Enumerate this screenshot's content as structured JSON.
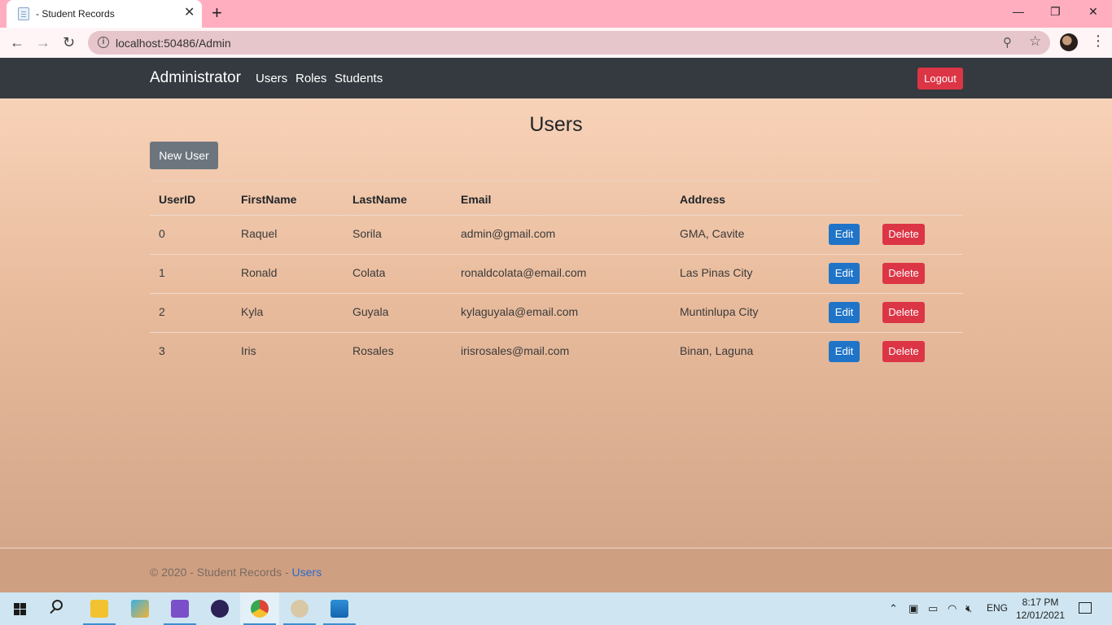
{
  "browser": {
    "tab_title": "- Student Records",
    "tab_close": "✕",
    "new_tab": "+",
    "url": "localhost:50486/Admin",
    "minimize": "—",
    "maximize": "❐",
    "close": "✕"
  },
  "navbar": {
    "brand": "Administrator",
    "links": [
      "Users",
      "Roles",
      "Students"
    ],
    "logout_label": "Logout"
  },
  "page": {
    "title": "Users",
    "new_user_label": "New User"
  },
  "table": {
    "headers": [
      "UserID",
      "FirstName",
      "LastName",
      "Email",
      "Address"
    ],
    "rows": [
      {
        "id": "0",
        "first": "Raquel",
        "last": "Sorila",
        "email": "admin@gmail.com",
        "address": "GMA, Cavite"
      },
      {
        "id": "1",
        "first": "Ronald",
        "last": "Colata",
        "email": "ronaldcolata@email.com",
        "address": "Las Pinas City"
      },
      {
        "id": "2",
        "first": "Kyla",
        "last": "Guyala",
        "email": "kylaguyala@email.com",
        "address": "Muntinlupa City"
      },
      {
        "id": "3",
        "first": "Iris",
        "last": "Rosales",
        "email": "irisrosales@mail.com",
        "address": "Binan, Laguna"
      }
    ],
    "edit_label": "Edit",
    "delete_label": "Delete"
  },
  "footer": {
    "text": "© 2020 - Student Records - ",
    "link": "Users"
  },
  "taskbar": {
    "language": "ENG",
    "time": "8:17 PM",
    "date": "12/01/2021"
  },
  "colors": {
    "navbar": "#343a40",
    "danger": "#dc3545",
    "primary": "#1f74c8",
    "secondary": "#6c757d",
    "tab_strip": "#ffaec0"
  }
}
